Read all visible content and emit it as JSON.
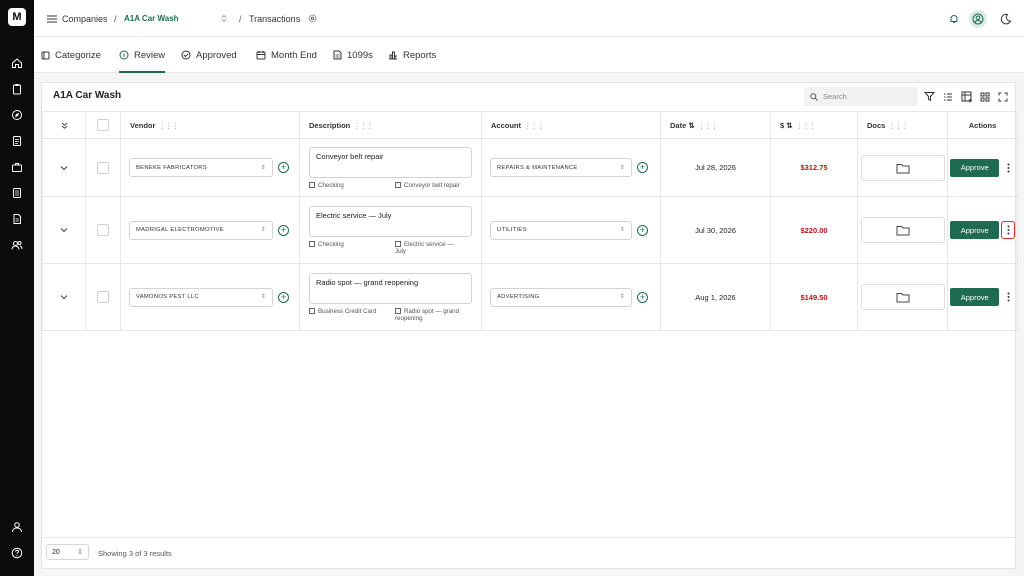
{
  "brand": {
    "logo_text": "M",
    "accent": "#1e6b52",
    "amount_color": "#b31717"
  },
  "sidebar": {
    "icons": [
      "home-icon",
      "clipboard-icon",
      "compass-icon",
      "document-icon",
      "briefcase-icon",
      "ledger-icon",
      "report-icon",
      "users-icon",
      "user-icon",
      "help-icon"
    ]
  },
  "breadcrumb": {
    "companies": "Companies",
    "separator": "/",
    "company": "A1A Car Wash",
    "page": "Transactions"
  },
  "tabs": [
    {
      "label": "Categorize",
      "icon": "categorize-icon"
    },
    {
      "label": "Review",
      "icon": "review-icon"
    },
    {
      "label": "Approved",
      "icon": "check-circle-icon"
    },
    {
      "label": "Month End",
      "icon": "calendar-icon"
    },
    {
      "label": "1099s",
      "icon": "file-icon"
    },
    {
      "label": "Reports",
      "icon": "bar-chart-icon"
    }
  ],
  "panel": {
    "title": "A1A Car Wash",
    "search_placeholder": "Search"
  },
  "columns": {
    "vendor": "Vendor",
    "description": "Description",
    "account": "Account",
    "date": "Date",
    "amount": "$",
    "docs": "Docs",
    "actions": "Actions"
  },
  "rows": [
    {
      "vendor": "BENEKE FABRICATORS",
      "description": "Conveyor belt repair",
      "payment": "Checking",
      "memo": "Conveyor belt repair",
      "account": "REPAIRS & MAINTENANCE",
      "date": "Jul 28, 2026",
      "amount": "$312.75",
      "approve": "Approve"
    },
    {
      "vendor": "MADRIGAL ELECTROMOTIVE",
      "description": "Electric service — July",
      "payment": "Checking",
      "memo": "Electric service — July",
      "account": "UTILITIES",
      "date": "Jul 30, 2026",
      "amount": "$220.00",
      "approve": "Approve"
    },
    {
      "vendor": "VAMONOS PEST LLC",
      "description": "Radio spot — grand reopening",
      "payment": "Business Credit Card",
      "memo": "Radio spot — grand reopening",
      "account": "ADVERTISING",
      "date": "Aug 1, 2026",
      "amount": "$149.50",
      "approve": "Approve"
    }
  ],
  "footer": {
    "page_size": "20",
    "showing": "Showing 3 of 3 results"
  }
}
